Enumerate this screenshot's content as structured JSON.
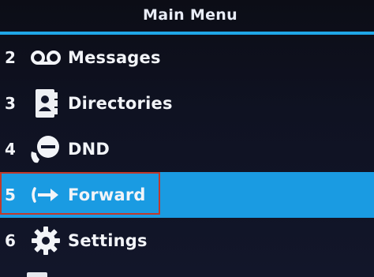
{
  "header": {
    "title": "Main Menu"
  },
  "menu": {
    "items": [
      {
        "number": "2",
        "label": "Messages",
        "icon": "voicemail-icon"
      },
      {
        "number": "3",
        "label": "Directories",
        "icon": "directory-icon"
      },
      {
        "number": "4",
        "label": "DND",
        "icon": "dnd-icon"
      },
      {
        "number": "5",
        "label": "Forward",
        "icon": "forward-icon",
        "selected": true
      },
      {
        "number": "6",
        "label": "Settings",
        "icon": "gear-icon"
      }
    ]
  },
  "colors": {
    "accent": "#1fa6e6",
    "selected_bg": "#1a9be2",
    "focus_border": "#c0392b",
    "text": "#f2f4f8"
  }
}
